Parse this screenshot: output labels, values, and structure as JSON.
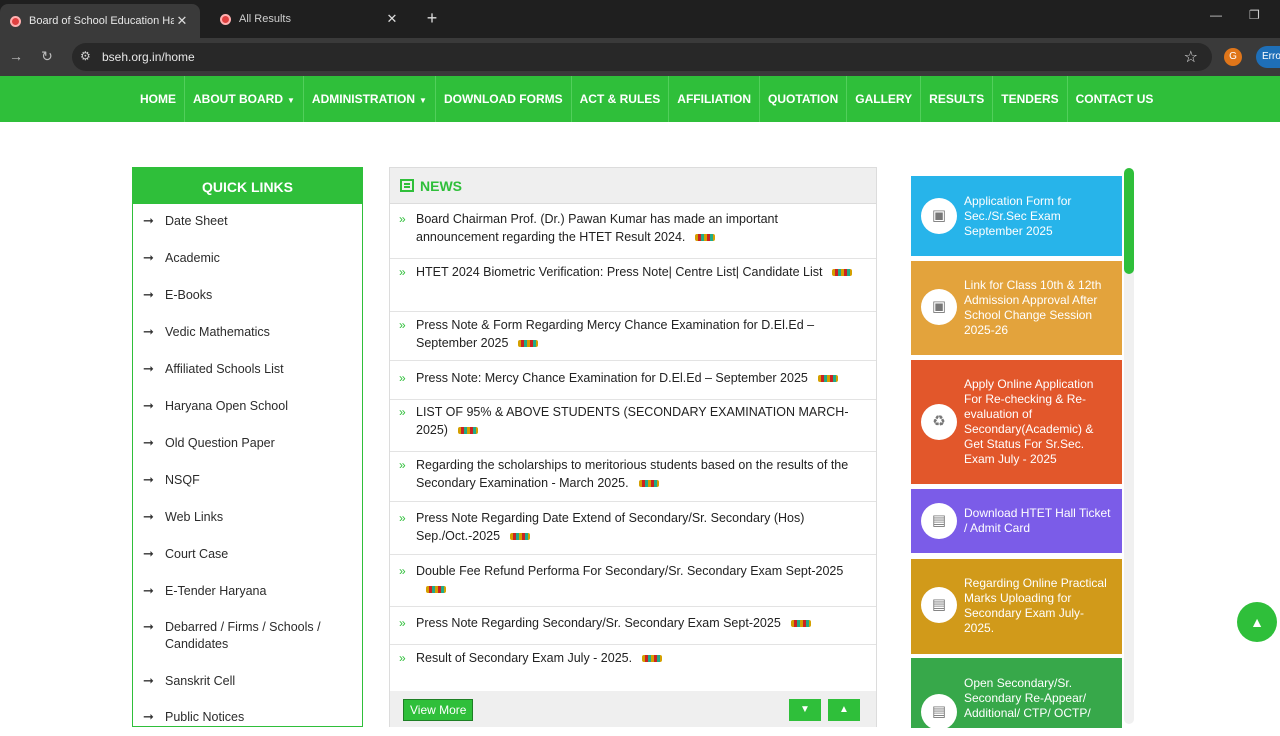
{
  "browser": {
    "tabs": [
      {
        "title": "Board of School Education Har",
        "active": true
      },
      {
        "title": "All Results",
        "active": false
      }
    ],
    "url": "bseh.org.in/home",
    "profile_initial": "G",
    "error_pill": "Erro"
  },
  "nav": {
    "items": [
      "HOME",
      "ABOUT BOARD",
      "ADMINISTRATION",
      "DOWNLOAD FORMS",
      "ACT & RULES",
      "AFFILIATION",
      "QUOTATION",
      "GALLERY",
      "RESULTS",
      "TENDERS",
      "CONTACT US"
    ]
  },
  "quick_links": {
    "title": "QUICK LINKS",
    "items": [
      "Date Sheet",
      "Academic",
      "E-Books",
      "Vedic Mathematics",
      "Affiliated Schools List",
      "Haryana Open School",
      "Old Question Paper",
      "NSQF",
      "Web Links",
      "Court Case",
      "E-Tender Haryana",
      "Debarred / Firms / Schools / Candidates",
      "Sanskrit Cell",
      "Public Notices"
    ]
  },
  "news": {
    "title": "NEWS",
    "items": [
      "Board Chairman Prof. (Dr.) Pawan Kumar has made an important announcement regarding the HTET Result 2024.",
      "HTET 2024 Biometric Verification: Press Note| Centre List| Candidate List",
      "Press Note & Form Regarding Mercy Chance Examination for D.El.Ed – September 2025",
      "Press Note: Mercy Chance Examination for D.El.Ed – September 2025",
      "LIST OF 95% & ABOVE STUDENTS (SECONDARY EXAMINATION MARCH-2025)",
      "Regarding the scholarships to meritorious students based on the results of the Secondary Examination - March 2025.",
      "Press Note Regarding Date Extend of Secondary/Sr. Secondary (Hos) Sep./Oct.-2025",
      "Double Fee Refund Performa For Secondary/Sr. Secondary Exam Sept-2025",
      "Press Note Regarding Secondary/Sr. Secondary Exam Sept-2025",
      "Result of Secondary Exam July - 2025."
    ],
    "view_more": "View More"
  },
  "cards": [
    {
      "text": "Application Form for Sec./Sr.Sec Exam September 2025",
      "color": "#27b4ea",
      "icon": "contact-book-icon"
    },
    {
      "text": "Link for Class 10th & 12th Admission Approval After School Change Session 2025-26",
      "color": "#e3a33c",
      "icon": "contact-book-icon"
    },
    {
      "text": "Apply Online Application For Re-checking & Re-evaluation of Secondary(Academic) & Get Status For Sr.Sec. Exam July - 2025",
      "color": "#e2572b",
      "icon": "recycle-icon"
    },
    {
      "text": "Download HTET Hall Ticket / Admit Card",
      "color": "#7b5ce8",
      "icon": "id-card-icon"
    },
    {
      "text": "Regarding Online Practical Marks Uploading for Secondary Exam July-2025.",
      "color": "#d19a1a",
      "icon": "id-card-icon"
    },
    {
      "text": "Open Secondary/Sr. Secondary Re-Appear/ Additional/ CTP/ OCTP/",
      "color": "#37a84a",
      "icon": "id-card-icon"
    }
  ]
}
